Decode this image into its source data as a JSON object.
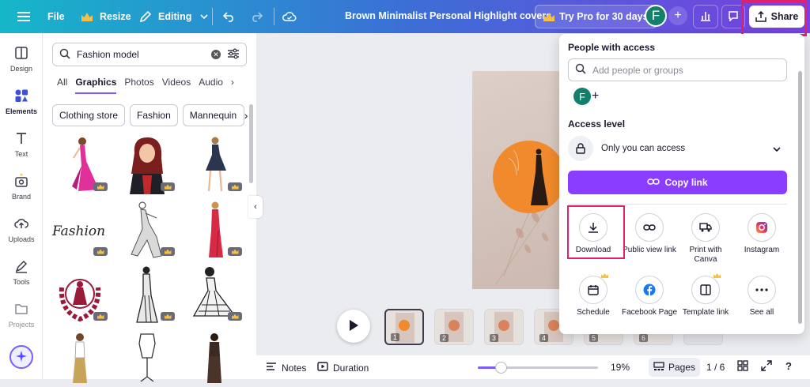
{
  "topbar": {
    "file": "File",
    "resize": "Resize",
    "editing": "Editing",
    "doc_title": "Brown Minimalist Personal Highlight covers",
    "try_pro": "Try Pro for 30 days",
    "avatar_initial": "F",
    "share": "Share"
  },
  "rail": {
    "items": [
      {
        "label": "Design",
        "icon": "design-icon"
      },
      {
        "label": "Elements",
        "icon": "elements-icon"
      },
      {
        "label": "Text",
        "icon": "text-icon"
      },
      {
        "label": "Brand",
        "icon": "brand-icon"
      },
      {
        "label": "Uploads",
        "icon": "uploads-icon"
      },
      {
        "label": "Tools",
        "icon": "tools-icon"
      },
      {
        "label": "Projects",
        "icon": "folder-icon"
      }
    ]
  },
  "panel": {
    "search_value": "Fashion model",
    "tabs": [
      "All",
      "Graphics",
      "Photos",
      "Videos",
      "Audio"
    ],
    "active_tab": "Graphics",
    "chips": [
      "Clothing store",
      "Fashion",
      "Mannequin"
    ],
    "fashion_script": "Fashion"
  },
  "bottom": {
    "notes": "Notes",
    "duration": "Duration",
    "zoom": "19%",
    "zoom_fraction": 0.19,
    "pages_label": "Pages",
    "page_counter": "1 / 6",
    "thumbs": [
      "1",
      "2",
      "3",
      "4",
      "5",
      "6"
    ]
  },
  "share_panel": {
    "people_heading": "People with access",
    "search_placeholder": "Add people or groups",
    "avatar_initial": "F",
    "access_heading": "Access level",
    "access_value": "Only you can access",
    "copy_link": "Copy link",
    "options": [
      {
        "label": "Download",
        "icon": "download-icon"
      },
      {
        "label": "Public view link",
        "icon": "link-icon"
      },
      {
        "label": "Print with Canva",
        "icon": "truck-icon"
      },
      {
        "label": "Instagram",
        "icon": "instagram-icon"
      },
      {
        "label": "Schedule",
        "icon": "calendar-icon"
      },
      {
        "label": "Facebook Page",
        "icon": "facebook-icon"
      },
      {
        "label": "Template link",
        "icon": "template-icon"
      },
      {
        "label": "See all",
        "icon": "more-icon"
      }
    ]
  },
  "colors": {
    "accent": "#8b3dff",
    "highlight": "#e0216c",
    "avatar": "#12806a",
    "orange_circle": "#f08a2c"
  }
}
